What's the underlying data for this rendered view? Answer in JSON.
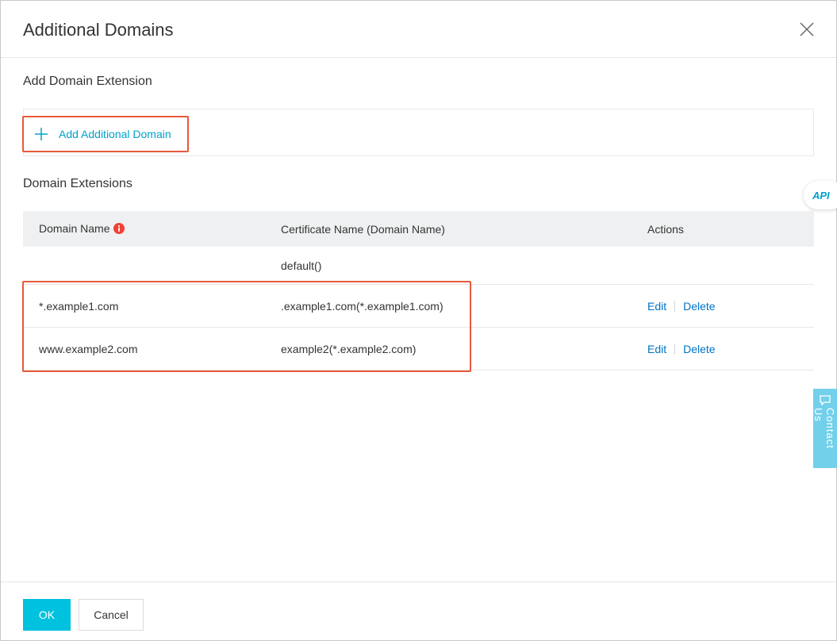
{
  "dialog": {
    "title": "Additional Domains",
    "close_icon": "close-icon"
  },
  "add_section": {
    "title": "Add Domain Extension",
    "add_button_label": "Add Additional Domain",
    "add_icon": "plus-icon"
  },
  "extensions_section": {
    "title": "Domain Extensions"
  },
  "table": {
    "headers": {
      "domain_name": "Domain Name",
      "certificate_name": "Certificate Name (Domain Name)",
      "actions": "Actions"
    },
    "rows": [
      {
        "domain": "",
        "certificate": "default()",
        "actions": []
      },
      {
        "domain": "*.example1.com",
        "certificate": ".example1.com(*.example1.com)",
        "actions": [
          "Edit",
          "Delete"
        ]
      },
      {
        "domain": "www.example2.com",
        "certificate": "example2(*.example2.com)",
        "actions": [
          "Edit",
          "Delete"
        ]
      }
    ]
  },
  "floating": {
    "api_label": "API",
    "contact_label": "Contact Us"
  },
  "footer": {
    "ok_label": "OK",
    "cancel_label": "Cancel"
  },
  "colors": {
    "accent": "#00c1de",
    "link": "#0073c6",
    "highlight": "#e8593a",
    "info": "#f04134"
  }
}
